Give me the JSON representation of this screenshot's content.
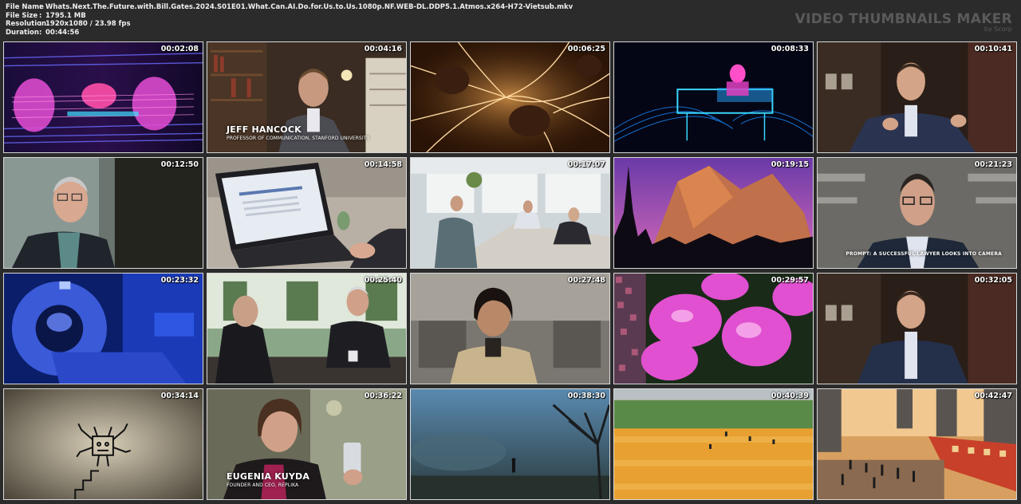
{
  "info": {
    "file_name_label": "File Name",
    "file_name": "Whats.Next.The.Future.with.Bill.Gates.2024.S01E01.What.Can.AI.Do.for.Us.to.Us.1080p.NF.WEB-DL.DDP5.1.Atmos.x264-H72-Vietsub.mkv",
    "file_size_label": "File Size",
    "file_size": "1795.1 MB",
    "resolution_label": "Resolution",
    "resolution": "1920x1080 / 23.98 fps",
    "duration_label": "Duration",
    "duration": "00:44:56",
    "separator": ":"
  },
  "brand": {
    "name": "VIDEO THUMBNAILS MAKER",
    "by": "by Scorp"
  },
  "thumbnails": [
    {
      "time": "00:02:08"
    },
    {
      "time": "00:04:16",
      "name": "JEFF HANCOCK",
      "title": "PROFESSOR OF COMMUNICATION, STANFORD UNIVERSITY"
    },
    {
      "time": "00:06:25"
    },
    {
      "time": "00:08:33"
    },
    {
      "time": "00:10:41"
    },
    {
      "time": "00:12:50"
    },
    {
      "time": "00:14:58"
    },
    {
      "time": "00:17:07"
    },
    {
      "time": "00:19:15"
    },
    {
      "time": "00:21:23",
      "prompt": "PROMPT: A SUCCESSFUL LAWYER LOOKS INTO CAMERA"
    },
    {
      "time": "00:23:32"
    },
    {
      "time": "00:25:40"
    },
    {
      "time": "00:27:48"
    },
    {
      "time": "00:29:57"
    },
    {
      "time": "00:32:05"
    },
    {
      "time": "00:34:14"
    },
    {
      "time": "00:36:22",
      "name": "EUGENIA KUYDA",
      "title": "FOUNDER AND CEO, REPLIKA"
    },
    {
      "time": "00:38:30"
    },
    {
      "time": "00:40:39"
    },
    {
      "time": "00:42:47"
    }
  ]
}
